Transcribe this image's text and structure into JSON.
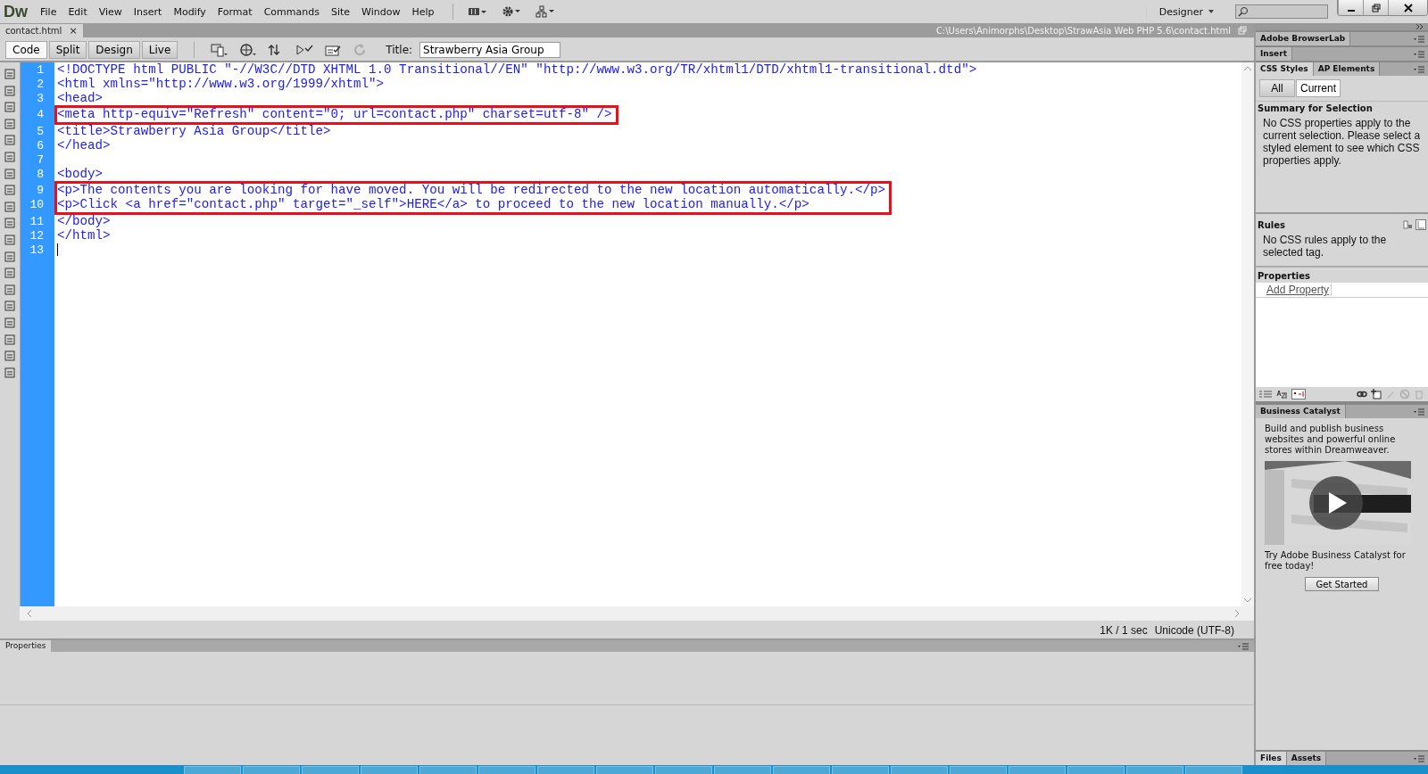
{
  "app": {
    "logo": "Dw",
    "menu": [
      "File",
      "Edit",
      "View",
      "Insert",
      "Modify",
      "Format",
      "Commands",
      "Site",
      "Window",
      "Help"
    ],
    "workspace": "Designer"
  },
  "document_tabs": [
    {
      "label": "contact.html",
      "close": "×",
      "selected": true
    }
  ],
  "file_path": "C:\\Users\\Animorphs\\Desktop\\StrawAsia Web PHP 5.6\\contact.html",
  "view_buttons": [
    {
      "label": "Code",
      "selected": true
    },
    {
      "label": "Split",
      "selected": false
    },
    {
      "label": "Design",
      "selected": false
    },
    {
      "label": "Live",
      "selected": false
    }
  ],
  "title_field": {
    "label": "Title:",
    "value": "Strawberry Asia Group"
  },
  "code_blocks": [
    {
      "highlighted": false,
      "lines": [
        {
          "number": "1",
          "text": "<!DOCTYPE html PUBLIC \"-//W3C//DTD XHTML 1.0 Transitional//EN\" \"http://www.w3.org/TR/xhtml1/DTD/xhtml1-transitional.dtd\">"
        },
        {
          "number": "2",
          "text": "<html xmlns=\"http://www.w3.org/1999/xhtml\">"
        },
        {
          "number": "3",
          "text": "<head>"
        }
      ]
    },
    {
      "highlighted": true,
      "lines": [
        {
          "number": "4",
          "text": "<meta http-equiv=\"Refresh\" content=\"0; url=contact.php\" charset=utf-8\" />"
        }
      ]
    },
    {
      "highlighted": false,
      "lines": [
        {
          "number": "5",
          "text": "<title>Strawberry Asia Group</title>"
        },
        {
          "number": "6",
          "text": "</head>"
        },
        {
          "number": "7"
        },
        {
          "number": "8",
          "text": "<body>"
        }
      ]
    },
    {
      "highlighted": true,
      "lines": [
        {
          "number": "9",
          "text": "<p>The contents you are looking for have moved. You will be redirected to the new location automatically.</p>"
        },
        {
          "number": "10",
          "text": "<p>Click <a href=\"contact.php\" target=\"_self\">HERE</a> to proceed to the new location manually.</p>"
        }
      ]
    },
    {
      "highlighted": false,
      "lines": [
        {
          "number": "11",
          "text": "</body>"
        },
        {
          "number": "12",
          "text": "</html>"
        },
        {
          "number": "13"
        }
      ]
    }
  ],
  "status_bar": {
    "size": "1K / 1 sec",
    "encoding": "Unicode (UTF-8)"
  },
  "properties_panel": {
    "title": "Properties"
  },
  "right_panel": {
    "panel_tabs": [
      {
        "label": "Adobe BrowserLab"
      },
      {
        "label": "Insert"
      }
    ],
    "css_tabs": [
      {
        "label": "CSS Styles",
        "selected": true
      },
      {
        "label": "AP Elements",
        "selected": false
      }
    ],
    "mode_buttons": [
      {
        "label": "All",
        "selected": false
      },
      {
        "label": "Current",
        "selected": true
      }
    ],
    "summary": {
      "heading": "Summary for Selection",
      "text": "No CSS properties apply to the current selection.  Please select a styled element to see which CSS properties apply."
    },
    "rules": {
      "heading": "Rules",
      "text": "No CSS rules apply to the selected tag."
    },
    "properties": {
      "heading": "Properties",
      "link": "Add Property"
    },
    "business_catalyst": {
      "tab": "Business Catalyst",
      "intro": "Build and publish business websites and powerful online stores within Dreamweaver.",
      "promo": "Try Adobe Business Catalyst for free today!",
      "button": "Get Started"
    },
    "bottom_tabs": [
      {
        "label": "Files",
        "selected": true
      },
      {
        "label": "Assets",
        "selected": false
      }
    ]
  }
}
